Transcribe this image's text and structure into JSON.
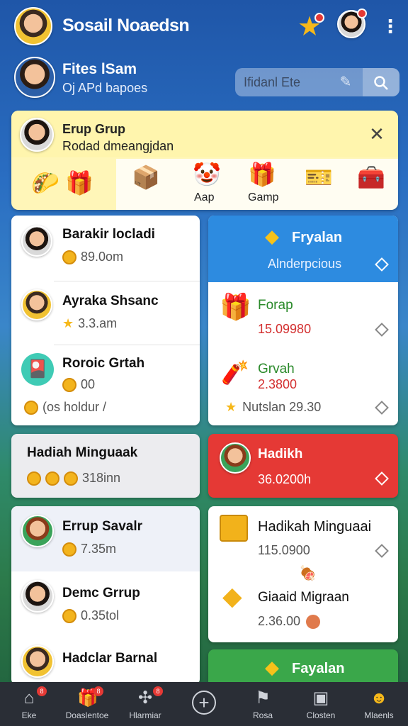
{
  "header": {
    "app_title": "Sosail Noaedsn",
    "star_icon": "star-icon",
    "colors": {
      "bar": "#1f56a8",
      "accent_yellow": "#f6b81a",
      "badge_red": "#e53935"
    }
  },
  "profile": {
    "name": "Fites lSam",
    "subtitle": "Oj APd bapoes"
  },
  "search": {
    "placeholder": "Ifidanl Ete"
  },
  "group_card": {
    "title": "Erup Grup",
    "subtitle": "Rodad dmeangjdan",
    "gifts": [
      {
        "icon": "gift-box-icon",
        "label": ""
      },
      {
        "icon": "character-icon",
        "label": "Aap"
      },
      {
        "icon": "present-icon",
        "label": "Gamp"
      },
      {
        "icon": "card-pack-icon",
        "label": ""
      },
      {
        "icon": "treasure-icon",
        "label": ""
      }
    ]
  },
  "left_list": [
    {
      "title": "Barakir locladi",
      "meta": "89.0om"
    },
    {
      "title": "Ayraka Shsanc",
      "meta": "3.3.am"
    },
    {
      "title": "Roroic Grtah",
      "meta": "00"
    }
  ],
  "left_list_footer": "(os  holdur /",
  "hadiah_card": {
    "title": "Hadiah Minguaak",
    "meta": "318inn"
  },
  "left_list2": [
    {
      "title": "Errup Savalr",
      "meta": "7.35m"
    },
    {
      "title": "Demc Grrup",
      "meta": "0.35tol"
    },
    {
      "title": "Hadclar Barnal",
      "meta": ""
    }
  ],
  "right_blue": {
    "title": "Fryalan",
    "subtitle": "Alnderpcious",
    "items": [
      {
        "title": "Forap",
        "value": "15.09980"
      },
      {
        "title": "Grvah",
        "value": "2.3800"
      }
    ],
    "footer": "Nutslan 29.30"
  },
  "right_red": {
    "title": "Hadikh",
    "value": "36.0200h"
  },
  "right_white": {
    "title": "Hadikah Minguaai",
    "value": "115.0900",
    "item_title": "Giaaid Migraan",
    "item_value": "2.36.00"
  },
  "right_green": {
    "title": "Fayalan"
  },
  "bottom_nav": [
    {
      "icon": "home-icon",
      "label": "Eke",
      "badge": "8"
    },
    {
      "icon": "gift-icon",
      "label": "Doaslentoe",
      "badge": "8"
    },
    {
      "icon": "puzzle-icon",
      "label": "Hlarmiar",
      "badge": "8"
    },
    {
      "icon": "plus-circle-icon",
      "label": ""
    },
    {
      "icon": "flag-icon",
      "label": "Rosa"
    },
    {
      "icon": "card-icon",
      "label": "Closten"
    },
    {
      "icon": "smile-icon",
      "label": "Mlaenls"
    }
  ]
}
